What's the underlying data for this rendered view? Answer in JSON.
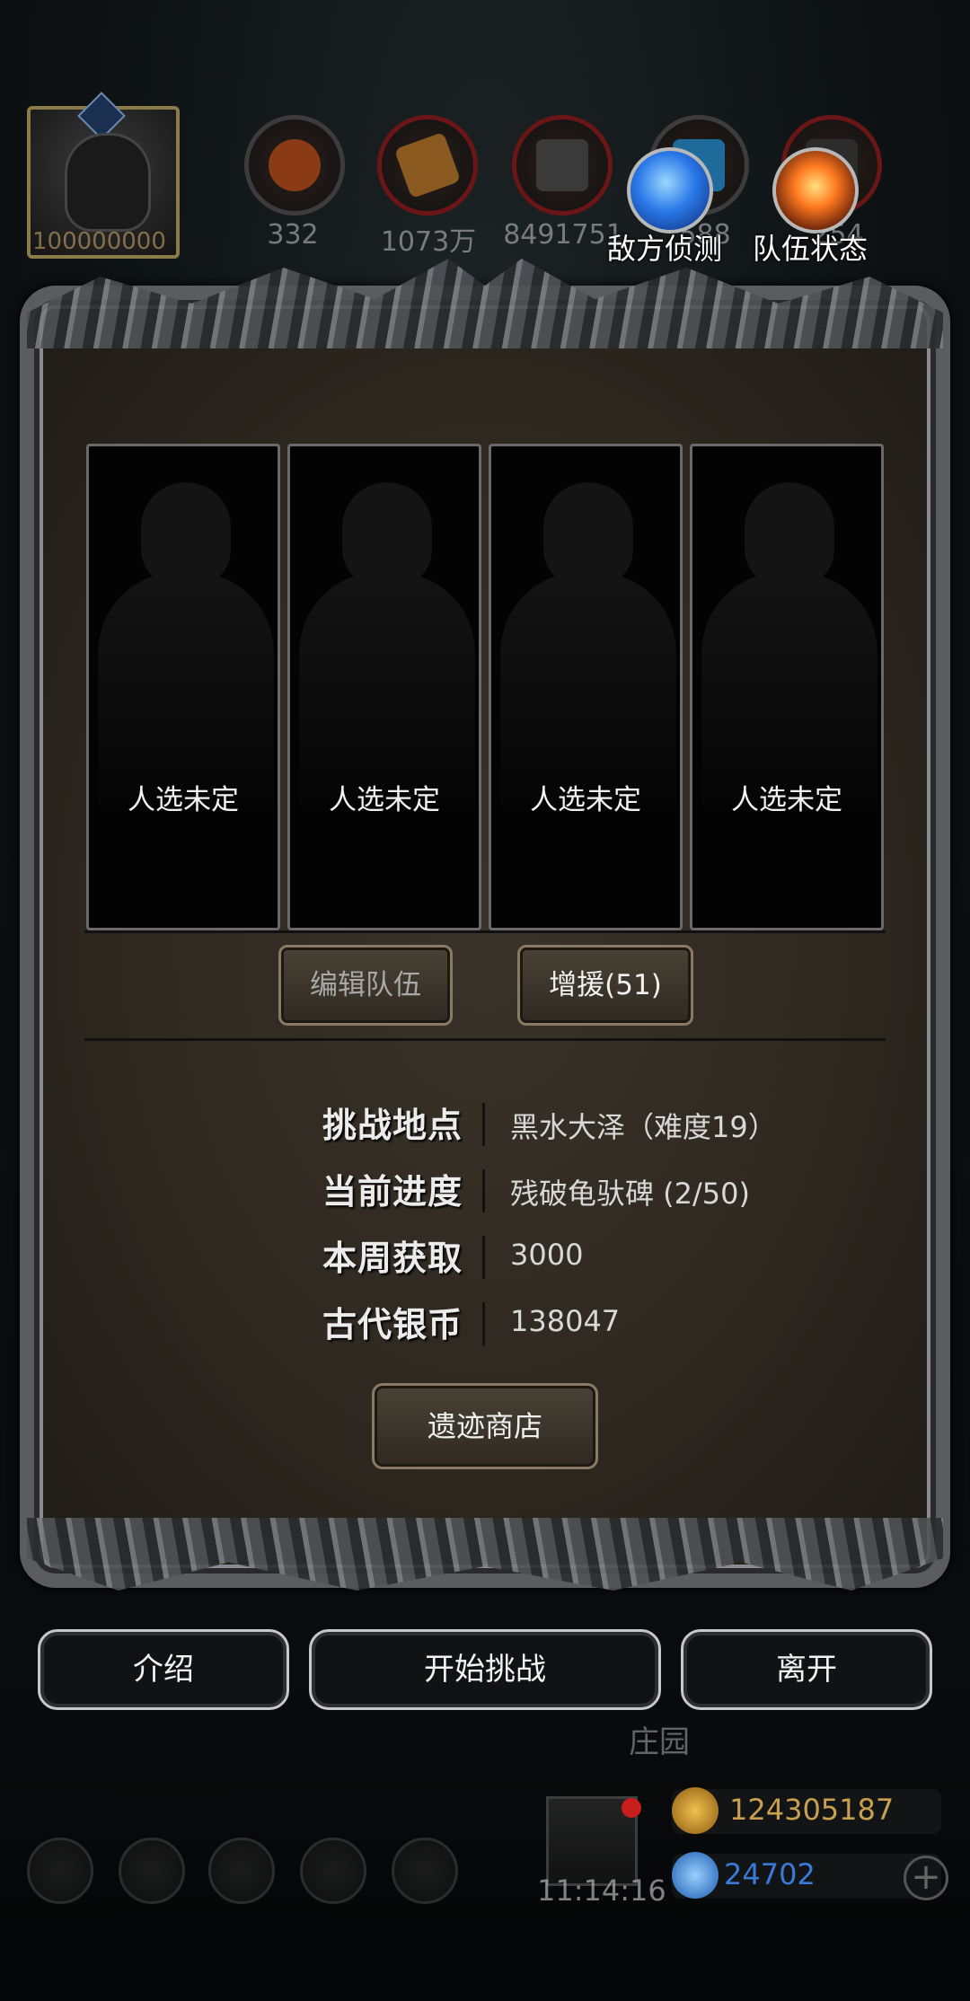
{
  "header": {
    "avatar_value": "100000000",
    "resources": [
      {
        "icon": "meat-icon",
        "value": "332"
      },
      {
        "icon": "wood-icon",
        "value": "1073万"
      },
      {
        "icon": "stone-icon",
        "value": "8491751"
      },
      {
        "icon": "crystal-icon",
        "value": "588"
      },
      {
        "icon": "iron-icon",
        "value": "254"
      }
    ],
    "actions": [
      {
        "icon": "blue-orb-icon",
        "label": "敌方侦测"
      },
      {
        "icon": "fire-orb-icon",
        "label": "队伍状态"
      }
    ]
  },
  "team": {
    "slots": [
      "人选未定",
      "人选未定",
      "人选未定",
      "人选未定"
    ],
    "edit_label": "编辑队伍",
    "reinforce_label": "增援(51)"
  },
  "info": {
    "rows": [
      {
        "key": "挑战地点",
        "value": "黑水大泽（难度19）"
      },
      {
        "key": "当前进度",
        "value": "残破龟驮碑 (2/50)"
      },
      {
        "key": "本周获取",
        "value": "3000"
      },
      {
        "key": "古代银币",
        "value": "138047"
      }
    ],
    "shop_label": "遗迹商店"
  },
  "footer": {
    "intro_label": "介绍",
    "start_label": "开始挑战",
    "leave_label": "离开",
    "location_label": "庄园",
    "clock": "11:14:16",
    "gold": "124305187",
    "gems": "24702",
    "plus": "+"
  },
  "colors": {
    "gold_text": "#c8a050",
    "gem_text": "#3a7ad8",
    "button_border": "#8a7a62"
  }
}
